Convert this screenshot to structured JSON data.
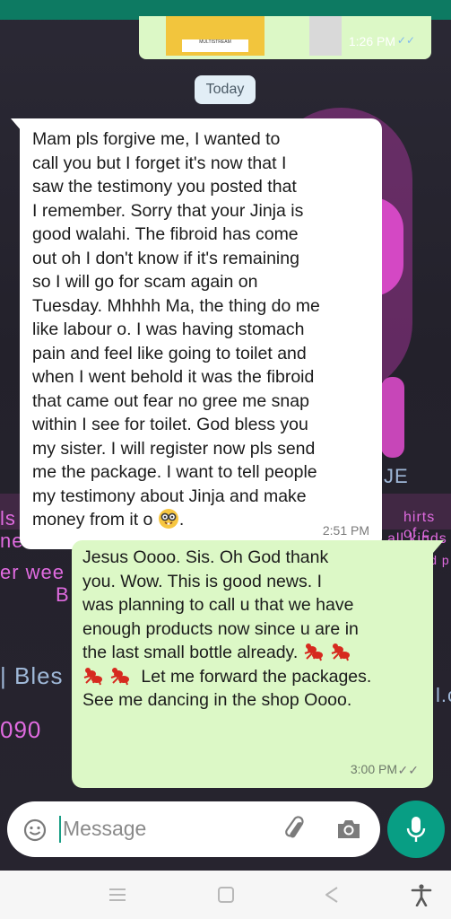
{
  "colors": {
    "header": "#0d7a62",
    "incoming_bubble": "#ffffff",
    "outgoing_bubble": "#dcf8c6",
    "accent": "#089e84",
    "read_ticks": "#7fb8f0"
  },
  "quoted_message": {
    "thumbnail_label": "MULTISTREAM",
    "time": "1:26 PM"
  },
  "wallpaper": {
    "text_fragments": [
      "ls",
      "ne",
      "er wee",
      "B",
      "| Bles",
      "090",
      "JE",
      "hirts of c",
      "all kinds",
      "l.c",
      "Norland p"
    ]
  },
  "chat": {
    "date_label": "Today",
    "messages": [
      {
        "direction": "incoming",
        "text": "Mam pls forgive me, I wanted to\ncall you but I forget it's now that I\nsaw the testimony you posted that\nI remember. Sorry that your Jinja is\ngood walahi. The fibroid has come\nout oh I don't know if it's remaining\nso I will go for scam again on\nTuesday. Mhhhh Ma, the thing do me\nlike labour o. I was having stomach\npain and feel like going to toilet and\nwhen I went behold it was the fibroid\nthat came out fear no gree me snap\nwithin I see for toilet. God bless you\nmy sister. I will register now pls send\nme the package. I want to tell people\nmy testimony about Jinja and make\nmoney from it o",
        "trailing_emoji": "nerd-face-emoji",
        "trailing_text": ".",
        "time": "2:51 PM"
      },
      {
        "direction": "outgoing",
        "text_part1": "Jesus Oooo. Sis. Oh God thank\nyou. Wow. This is good news. I\nwas planning to call u that we have\nenough products now since u are in\nthe last small bottle already. ",
        "emoji": "dancing-ant-emoji",
        "text_part2": " Let me forward the packages.\nSee me dancing in the shop Oooo.",
        "time": "3:00 PM",
        "status": "read"
      }
    ]
  },
  "composer": {
    "placeholder": "Message",
    "icons": [
      "emoji-icon",
      "attach-icon",
      "camera-icon",
      "mic-icon"
    ]
  },
  "system_nav": {
    "icons": [
      "recents-icon",
      "home-icon",
      "back-icon",
      "accessibility-icon"
    ]
  }
}
